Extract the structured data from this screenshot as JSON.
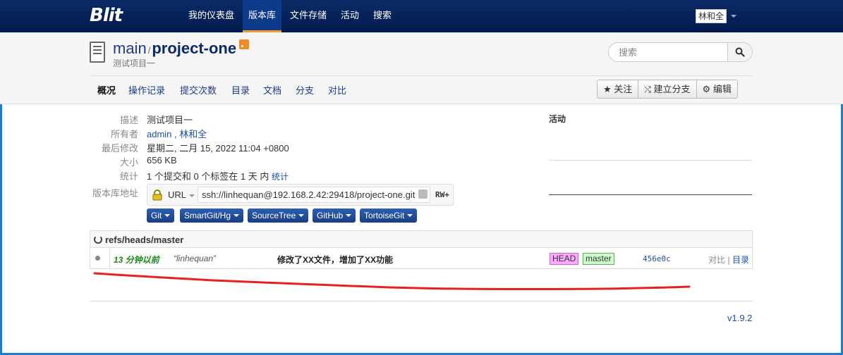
{
  "navbar": {
    "logo": "Blit",
    "items": [
      "我的仪表盘",
      "版本库",
      "文件存储",
      "活动",
      "搜索"
    ],
    "active": "版本库",
    "user": "林和全"
  },
  "repo": {
    "owner": "main",
    "separator": "/",
    "name": "project-one",
    "description": "测试项目一"
  },
  "search": {
    "placeholder": "搜索"
  },
  "tabs": [
    "概况",
    "操作记录",
    "提交次数",
    "目录",
    "文档",
    "分支",
    "对比"
  ],
  "actions": [
    "关注",
    "建立分支",
    "编辑"
  ],
  "summary": {
    "labels": {
      "description": "描述",
      "owners": "所有者",
      "last_modified": "最后修改",
      "size": "大小",
      "stats": "统计",
      "repo_url": "版本库地址"
    },
    "description": "测试项目一",
    "owner_admin": "admin",
    "owner_sep": " , ",
    "owner_user": "林和全",
    "last_modified": "星期二, 二月 15, 2022 11:04 +0800",
    "size": "656 KB",
    "stats": "1 个提交和 0 个标签在 1 天 内",
    "stats_link": "统计",
    "url_protocol": "URL",
    "url": "ssh://linhequan@192.168.2.42:29418/project-one.git",
    "permission": "RW+",
    "clients": [
      "Git",
      "SmartGit/Hg",
      "SourceTree",
      "GitHub",
      "TortoiseGit"
    ]
  },
  "activity": {
    "title": "活动"
  },
  "refs": {
    "title": "refs/heads/master",
    "commits": [
      {
        "age": "13 分钟以前",
        "author": "“linhequan”",
        "message": "修改了XX文件，增加了XX功能",
        "tags": [
          "HEAD",
          "master"
        ],
        "sha": "456e0c",
        "link_compare": "对比",
        "link_sep": " | ",
        "link_tree": "目录"
      }
    ]
  },
  "footer": {
    "version": "v1.9.2"
  },
  "colors": {
    "navbar": "#0b2a66",
    "accent": "#f0a030",
    "annotation": "#e82020"
  }
}
